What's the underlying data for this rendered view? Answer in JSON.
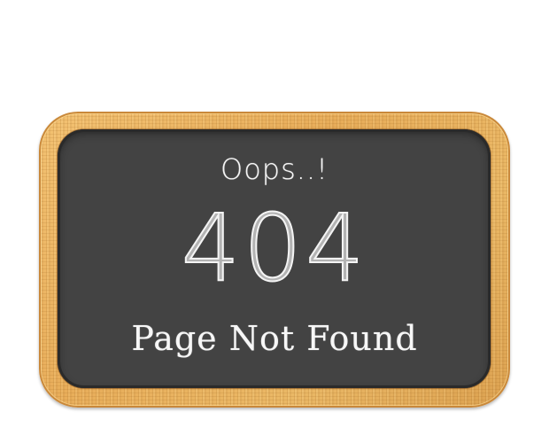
{
  "sign": {
    "headline": "Oops..!",
    "error_code": "404",
    "message": "Page Not Found"
  },
  "colors": {
    "background": "#ffffff",
    "board": "#434343",
    "frame": "#e8ad5a",
    "chalk": "#f7f7f7"
  }
}
